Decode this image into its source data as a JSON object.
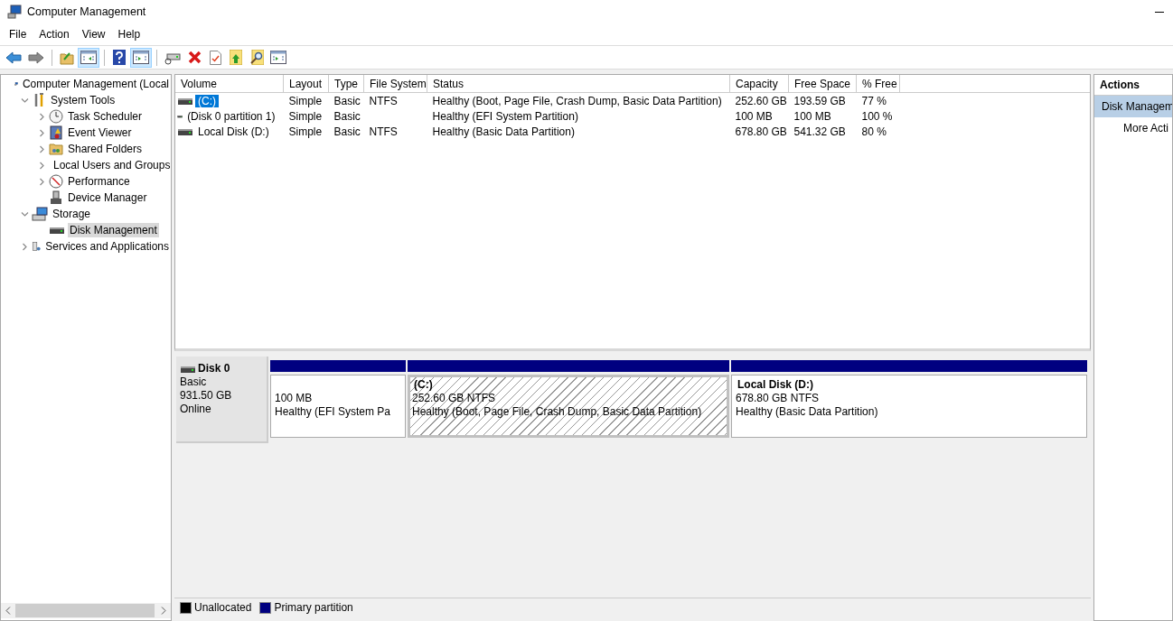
{
  "window": {
    "title": "Computer Management"
  },
  "menu": [
    "File",
    "Action",
    "View",
    "Help"
  ],
  "toolbar_groups": [
    [
      {
        "pressed": false
      },
      {
        "pressed": false
      }
    ],
    [
      {
        "pressed": false
      },
      {
        "pressed": true
      }
    ],
    [
      {
        "pressed": false
      },
      {
        "pressed": true
      }
    ],
    [
      {
        "pressed": false
      },
      {
        "pressed": false
      },
      {
        "pressed": false
      },
      {
        "pressed": false
      },
      {
        "pressed": false
      },
      {
        "pressed": false
      }
    ]
  ],
  "tree": [
    {
      "label": "Computer Management (Local",
      "selected": false,
      "children": [
        {
          "label": "System Tools",
          "expanded": true,
          "selected": false,
          "children": [
            {
              "label": "Task Scheduler",
              "expanded": false,
              "selected": false
            },
            {
              "label": "Event Viewer",
              "expanded": false,
              "selected": false
            },
            {
              "label": "Shared Folders",
              "expanded": false,
              "selected": false
            },
            {
              "label": "Local Users and Groups",
              "expanded": false,
              "selected": false
            },
            {
              "label": "Performance",
              "expanded": false,
              "selected": false
            },
            {
              "label": "Device Manager",
              "selected": false
            }
          ]
        },
        {
          "label": "Storage",
          "expanded": true,
          "selected": false,
          "children": [
            {
              "label": "Disk Management",
              "selected": true
            }
          ]
        },
        {
          "label": "Services and Applications",
          "expanded": false,
          "selected": false
        }
      ]
    }
  ],
  "volume_table": {
    "columns": [
      "Volume",
      "Layout",
      "Type",
      "File System",
      "Status",
      "Capacity",
      "Free Space",
      "% Free"
    ],
    "rows": [
      {
        "selected": true,
        "cells": [
          "(C:)",
          "Simple",
          "Basic",
          "NTFS",
          "Healthy (Boot, Page File, Crash Dump, Basic Data Partition)",
          "252.60 GB",
          "193.59 GB",
          "77 %"
        ]
      },
      {
        "selected": false,
        "cells": [
          "(Disk 0 partition 1)",
          "Simple",
          "Basic",
          "",
          "Healthy (EFI System Partition)",
          "100 MB",
          "100 MB",
          "100 %"
        ]
      },
      {
        "selected": false,
        "cells": [
          "Local Disk  (D:)",
          "Simple",
          "Basic",
          "NTFS",
          "Healthy (Basic Data Partition)",
          "678.80 GB",
          "541.32 GB",
          "80 %"
        ]
      }
    ]
  },
  "disk": {
    "name": "Disk 0",
    "type": "Basic",
    "size": "931.50 GB",
    "status": "Online",
    "partitions": [
      {
        "selected": false,
        "size": "100 MB",
        "status": "Healthy (EFI System Pa"
      },
      {
        "selected": true,
        "title": "(C:)",
        "size": "252.60 GB NTFS",
        "status": "Healthy (Boot, Page File, Crash Dump, Basic Data Partition)"
      },
      {
        "selected": false,
        "title": "Local Disk   (D:)",
        "size": "678.80 GB NTFS",
        "status": "Healthy (Basic Data Partition)"
      }
    ]
  },
  "legend": [
    {
      "label": "Unallocated",
      "color": "#000000"
    },
    {
      "label": "Primary partition",
      "color": "#000080"
    }
  ],
  "actions": {
    "header": "Actions",
    "items": [
      {
        "label": "Disk Managem",
        "kind": "section"
      },
      {
        "label": "More Acti",
        "kind": "link"
      }
    ]
  }
}
